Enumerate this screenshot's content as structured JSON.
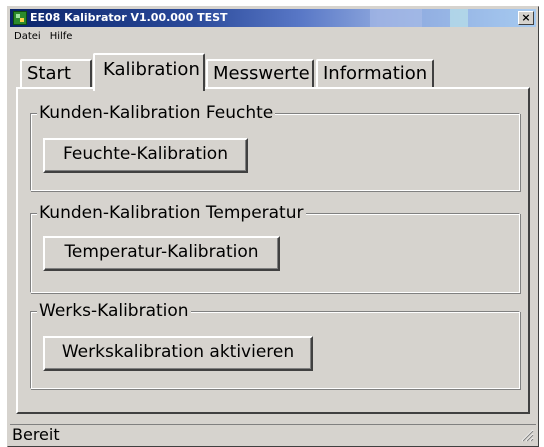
{
  "window": {
    "title": "EE08 Kalibrator V1.00.000 TEST",
    "close_glyph": "×",
    "app_icon": "app-logo-icon"
  },
  "menu": {
    "items": [
      "Datei",
      "Hilfe"
    ]
  },
  "tabs": {
    "items": [
      "Start",
      "Kalibration",
      "Messwerte",
      "Information"
    ],
    "active": "Kalibration"
  },
  "groups": [
    {
      "label": "Kunden-Kalibration Feuchte",
      "button": "Feuchte-Kalibration"
    },
    {
      "label": "Kunden-Kalibration Temperatur",
      "button": "Temperatur-Kalibration"
    },
    {
      "label": "Werks-Kalibration",
      "button": "Werkskalibration aktivieren"
    }
  ],
  "status": {
    "text": "Bereit",
    "grip_icon": "size-grip-icon"
  },
  "colors": {
    "face": "#d6d3ce",
    "title_start": "#0a246a",
    "title_end": "#a6caf0"
  }
}
